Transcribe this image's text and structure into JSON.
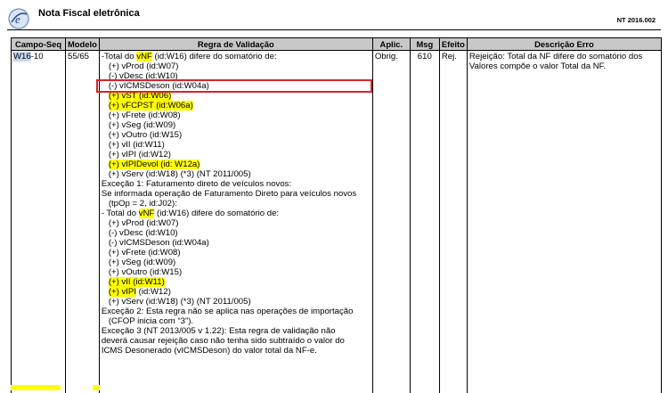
{
  "header": {
    "title": "Nota Fiscal eletrônica",
    "code": "NT 2016.002"
  },
  "table": {
    "columns": [
      "Campo-Seq",
      "Modelo",
      "Regra de Validação",
      "Aplic.",
      "Msg",
      "Efeito",
      "Descrição Erro"
    ],
    "row": {
      "campo_id": "W16",
      "campo_seq": "-10",
      "modelo": "55/65",
      "aplic": "Obrig.",
      "msg": "610",
      "efeito": "Rej.",
      "descricao": "Rejeição: Total da NF difere do somatório dos Valores compõe o valor Total da NF.",
      "rule_lines": [
        {
          "indent": 0,
          "parts": [
            {
              "t": "-Total do "
            },
            {
              "t": "vNF",
              "hl": true
            },
            {
              "t": " (id:W16) difere do somatório de:"
            }
          ]
        },
        {
          "indent": 1,
          "parts": [
            {
              "t": "(+) vProd (id:W07)"
            }
          ]
        },
        {
          "indent": 1,
          "parts": [
            {
              "t": "(-) vDesc (id:W10)"
            }
          ]
        },
        {
          "indent": 1,
          "boxed": true,
          "parts": [
            {
              "t": "(-) vICMSDeson (id:W04a)"
            }
          ]
        },
        {
          "indent": 1,
          "parts": [
            {
              "t": "(+) vST (id:W06)",
              "hl": true
            }
          ]
        },
        {
          "indent": 1,
          "parts": [
            {
              "t": "(+) vFCPST (id:W06a)",
              "hl": true
            }
          ]
        },
        {
          "indent": 1,
          "parts": [
            {
              "t": "(+) vFrete (id:W08)"
            }
          ]
        },
        {
          "indent": 1,
          "parts": [
            {
              "t": "(+) vSeg (id:W09)"
            }
          ]
        },
        {
          "indent": 1,
          "parts": [
            {
              "t": "(+) vOutro (id:W15)"
            }
          ]
        },
        {
          "indent": 1,
          "parts": [
            {
              "t": "(+) vII (id:W11)"
            }
          ]
        },
        {
          "indent": 1,
          "parts": [
            {
              "t": "(+) vIPI (id:W12)"
            }
          ]
        },
        {
          "indent": 1,
          "parts": [
            {
              "t": "(+) vIPIDevol (id: W12a)",
              "hl": true
            }
          ]
        },
        {
          "indent": 1,
          "parts": [
            {
              "t": "(+) vServ (id:W18) (*3) (NT 2011/005)"
            }
          ]
        },
        {
          "indent": 0,
          "parts": [
            {
              "t": "Exceção 1: Faturamento direto de veículos novos:"
            }
          ]
        },
        {
          "indent": 0,
          "parts": [
            {
              "t": "Se informada operação de Faturamento Direto para veículos novos"
            }
          ]
        },
        {
          "indent": 1,
          "parts": [
            {
              "t": "(tpOp = 2, id:J02):"
            }
          ]
        },
        {
          "indent": 0,
          "parts": [
            {
              "t": "- Total do "
            },
            {
              "t": "vNF",
              "hl": true
            },
            {
              "t": " (id:W16) difere do somatório de:"
            }
          ]
        },
        {
          "indent": 1,
          "parts": [
            {
              "t": "(+) vProd (id:W07)"
            }
          ]
        },
        {
          "indent": 1,
          "parts": [
            {
              "t": "(-) vDesc (id:W10)"
            }
          ]
        },
        {
          "indent": 1,
          "parts": [
            {
              "t": "(-) vICMSDeson (id:W04a)"
            }
          ]
        },
        {
          "indent": 1,
          "parts": [
            {
              "t": "(+) vFrete (id:W08)"
            }
          ]
        },
        {
          "indent": 1,
          "parts": [
            {
              "t": "(+) vSeg (id:W09)"
            }
          ]
        },
        {
          "indent": 1,
          "parts": [
            {
              "t": "(+) vOutro (id:W15)"
            }
          ]
        },
        {
          "indent": 1,
          "parts": [
            {
              "t": "(+) vII (id:W11)",
              "hl": true
            }
          ]
        },
        {
          "indent": 1,
          "parts": [
            {
              "t": "(+) vIPI",
              "hl": true
            },
            {
              "t": " (id:W12)"
            }
          ]
        },
        {
          "indent": 1,
          "parts": [
            {
              "t": "(+) vServ (id:W18) (*3) (NT 2011/005)"
            }
          ]
        },
        {
          "indent": 0,
          "parts": [
            {
              "t": "Exceção 2: Esta regra não se aplica nas operações de importação"
            }
          ]
        },
        {
          "indent": 1,
          "parts": [
            {
              "t": "(CFOP inicia com “3”)."
            }
          ]
        },
        {
          "indent": 0,
          "parts": [
            {
              "t": "Exceção 3 (NT 2013/005 v 1.22): Esta regra de validação não"
            }
          ]
        },
        {
          "indent": 0,
          "parts": [
            {
              "t": "deverá causar rejeição caso não tenha sido subtraído o valor do"
            }
          ]
        },
        {
          "indent": 0,
          "parts": [
            {
              "t": "ICMS Desonerado (vICMSDeson) do valor total da NF-e."
            }
          ]
        }
      ]
    }
  },
  "colors": {
    "highlight": "#ffff00",
    "box_outline": "#d8232a",
    "header_bg": "#c8c8c8",
    "field_selection": "#c8d6ee"
  },
  "icons": {
    "logo": "nfe-logo-icon"
  }
}
